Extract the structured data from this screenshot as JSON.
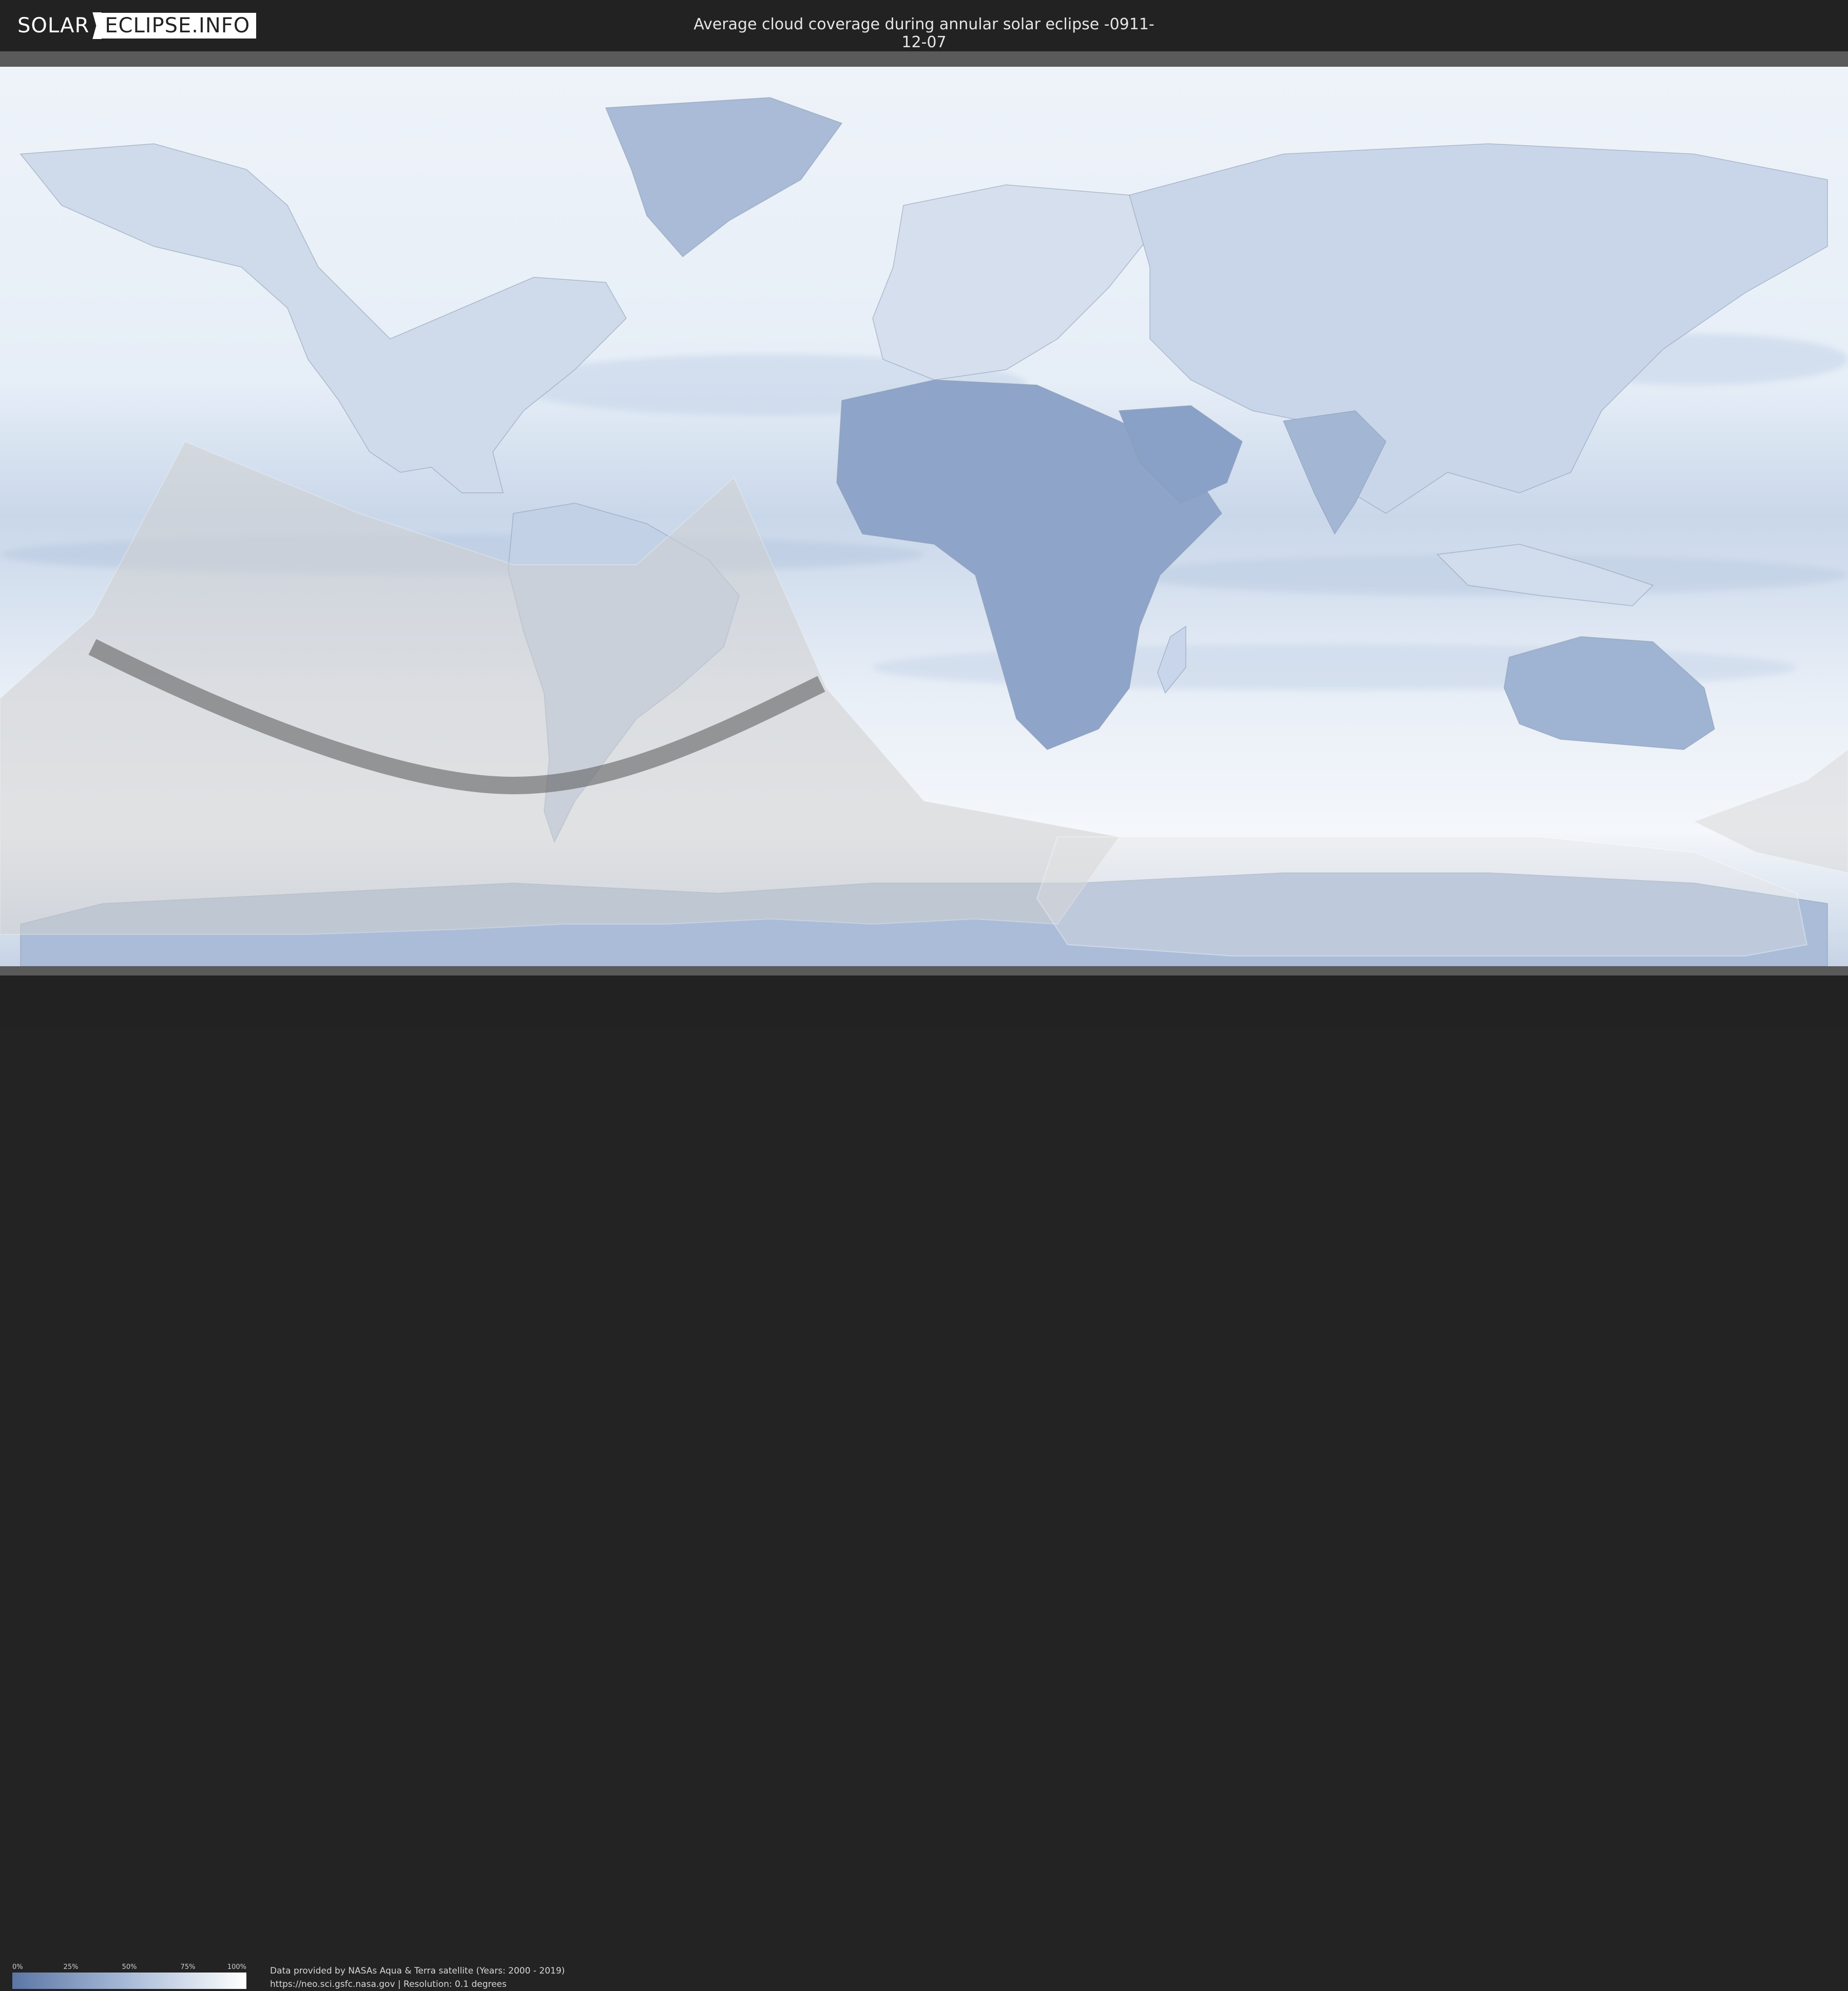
{
  "header": {
    "logo_part1": "SOLAR",
    "logo_part2": "ECLIPSE.INFO",
    "title": "Average cloud coverage during annular solar eclipse -0911-12-07"
  },
  "legend": {
    "ticks": [
      "0%",
      "25%",
      "50%",
      "75%",
      "100%"
    ],
    "gradient_colors": [
      "#5c76a5",
      "#a9bcd8",
      "#ffffff"
    ]
  },
  "attribution": {
    "line1": "Data provided by NASAs Aqua & Terra satellite (Years: 2000 - 2019)",
    "line2": "https://neo.sci.gsfc.nasa.gov | Resolution: 0.1 degrees"
  },
  "colors": {
    "ocean_cloud": "#dfe8f3",
    "land_clear": "#7d95bf",
    "eclipse_shadow": "#d9d9d9",
    "central_line": "#555555"
  }
}
